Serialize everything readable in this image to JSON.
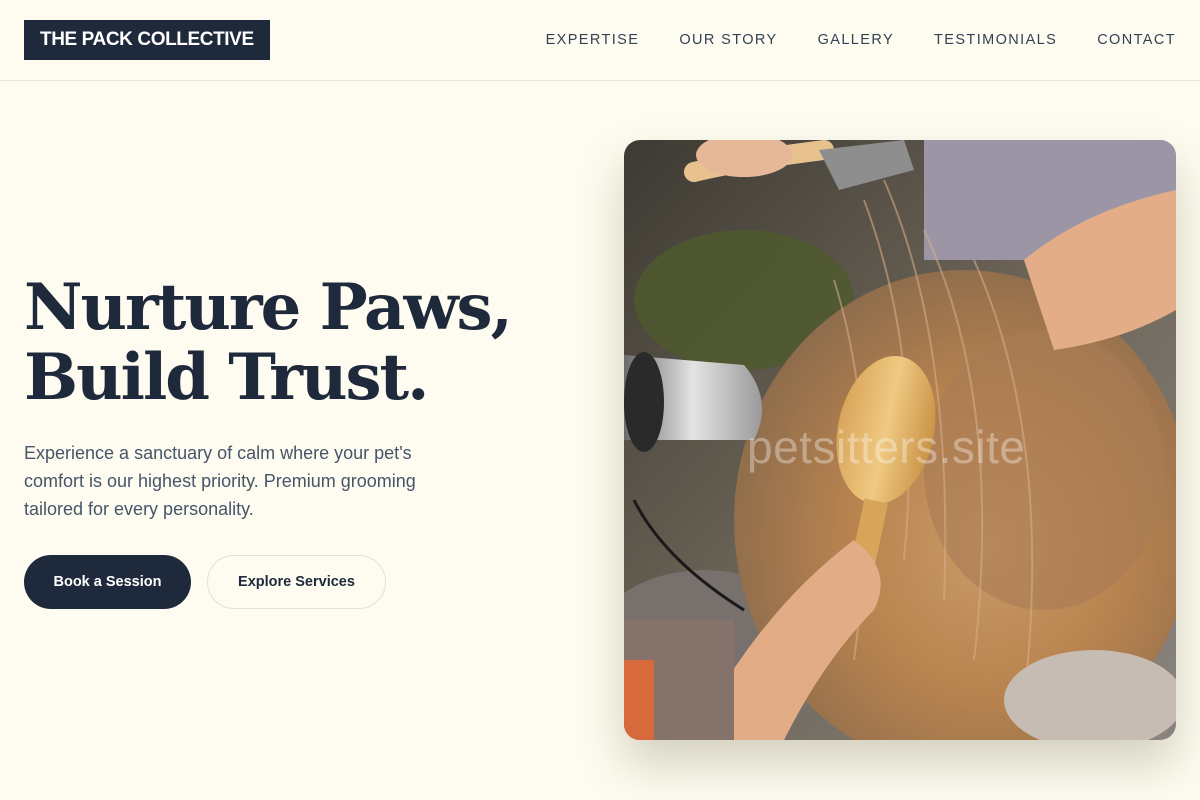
{
  "brand": {
    "logo_text": "THE PACK COLLECTIVE"
  },
  "nav": {
    "items": [
      {
        "label": "EXPERTISE"
      },
      {
        "label": "OUR STORY"
      },
      {
        "label": "GALLERY"
      },
      {
        "label": "TESTIMONIALS"
      },
      {
        "label": "CONTACT"
      }
    ]
  },
  "hero": {
    "headline_line1": "Nurture Paws,",
    "headline_line2": "Build Trust.",
    "description": "Experience a sanctuary of calm where your pet's comfort is our highest priority. Premium grooming tailored for every personality.",
    "primary_button": "Book a Session",
    "secondary_button": "Explore Services",
    "image_watermark": "petsitters.site"
  },
  "colors": {
    "background": "#fefcf0",
    "primary": "#1e293b",
    "text_muted": "#475569"
  }
}
